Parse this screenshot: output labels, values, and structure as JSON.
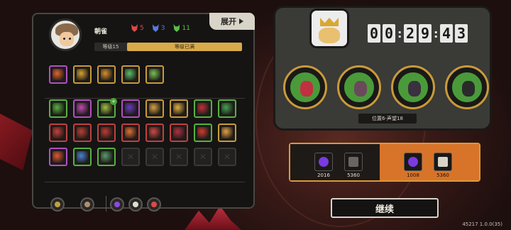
{
  "player": {
    "name": "朝雀",
    "level_label": "等级15",
    "level_status": "等级已满",
    "stats": [
      {
        "icon": "red-mask-icon",
        "value": "5",
        "color": "#e04848"
      },
      {
        "icon": "blue-mask-icon",
        "value": "3",
        "color": "#5a78e0"
      },
      {
        "icon": "green-mask-icon",
        "value": "11",
        "color": "#58c048"
      }
    ]
  },
  "panel": {
    "expand_label": "展开"
  },
  "relics": [
    {
      "icon": "flame-gauntlet-icon",
      "color": "#e0642a",
      "border": "#b050c0"
    },
    {
      "icon": "golden-claw-icon",
      "color": "#d8a030",
      "border": "#c89a3a"
    },
    {
      "icon": "bomb-icon",
      "color": "#d8902a",
      "border": "#c89a3a"
    },
    {
      "icon": "green-tree-icon",
      "color": "#58c068",
      "border": "#c89a3a"
    },
    {
      "icon": "green-swirl-icon",
      "color": "#78c050",
      "border": "#c89a3a"
    }
  ],
  "skills": {
    "rows": [
      [
        {
          "icon": "green-blade-icon",
          "color": "#58b040",
          "border": "#58b040"
        },
        {
          "icon": "purple-book-icon",
          "color": "#c04ab0",
          "border": "#b050c0"
        },
        {
          "icon": "green-staff-icon",
          "color": "#a0c040",
          "border": "#58b040",
          "badge": "+"
        },
        {
          "icon": "purple-cloak-icon",
          "color": "#6a3ac0",
          "border": "#b050c0"
        },
        {
          "icon": "golden-fist-icon",
          "color": "#d8a040",
          "border": "#c89a3a"
        },
        {
          "icon": "spark-burst-icon",
          "color": "#e0b040",
          "border": "#c89a3a"
        },
        {
          "icon": "red-cape-icon",
          "color": "#c03038",
          "border": "#58b040"
        },
        {
          "icon": "green-shrine-icon",
          "color": "#48a050",
          "border": "#58b040"
        }
      ],
      [
        {
          "icon": "triple-blades-icon",
          "color": "#c84038",
          "border": "#c04040"
        },
        {
          "icon": "crossed-swords-icon",
          "color": "#b84030",
          "border": "#c04040"
        },
        {
          "icon": "red-warrior-icon",
          "color": "#c03a30",
          "border": "#c04040"
        },
        {
          "icon": "fire-slash-icon",
          "color": "#e07030",
          "border": "#c04040"
        },
        {
          "icon": "demon-face-icon",
          "color": "#d04840",
          "border": "#c04040"
        },
        {
          "icon": "crimson-claw-icon",
          "color": "#b03040",
          "border": "#c04040"
        },
        {
          "icon": "red-sigil-icon",
          "color": "#d03a30",
          "border": "#58b040"
        },
        {
          "icon": "sun-fan-icon",
          "color": "#e0a040",
          "border": "#c89a3a"
        }
      ],
      [
        {
          "icon": "fire-dash-icon",
          "color": "#e05a30",
          "border": "#b050c0"
        },
        {
          "icon": "blue-spear-icon",
          "color": "#4a80d0",
          "border": "#58b040"
        },
        {
          "icon": "bird-spirit-icon",
          "color": "#5a9a6a",
          "border": "#58b040"
        },
        {
          "icon": "empty-slot-icon",
          "empty": true
        },
        {
          "icon": "empty-slot-icon",
          "empty": true
        },
        {
          "icon": "empty-slot-icon",
          "empty": true
        },
        {
          "icon": "empty-slot-icon",
          "empty": true
        },
        {
          "icon": "empty-slot-icon",
          "empty": true
        }
      ]
    ]
  },
  "bottom_bar": [
    {
      "icon": "target-ring-icon",
      "color": "#c0a040"
    },
    {
      "icon": "wand-icon",
      "color": "#b09070"
    },
    {
      "icon": "vortex-icon",
      "color": "#8a4ae0"
    },
    {
      "icon": "potion-icon",
      "color": "#e0e0d0"
    },
    {
      "icon": "star-burst-icon",
      "color": "#e04848"
    }
  ],
  "boss": {
    "icon": "king-portrait-icon"
  },
  "timer": {
    "digits": [
      "0",
      "0",
      "2",
      "9",
      "4",
      "3"
    ]
  },
  "enemies": [
    {
      "icon": "insect-enemy-icon",
      "feature_color": "#c03040"
    },
    {
      "icon": "horned-demon-icon",
      "feature_color": "#6a4a5a"
    },
    {
      "icon": "cloaked-figure-icon",
      "feature_color": "#3a3040"
    },
    {
      "icon": "glasses-man-icon",
      "feature_color": "#2a2a2a"
    }
  ],
  "position_label": "位置6-声望18",
  "rewards": {
    "left": [
      {
        "icon": "purple-orb-icon",
        "value": "2016",
        "color": "#7a3ae0"
      },
      {
        "icon": "dark-block-icon",
        "value": "5360",
        "color": "#6a6560"
      }
    ],
    "right": [
      {
        "icon": "purple-orb-icon",
        "value": "1008",
        "color": "#7a3ae0"
      },
      {
        "icon": "upgrade-block-icon",
        "value": "5360",
        "color": "#d8d4c8"
      }
    ]
  },
  "continue_label": "继续",
  "version": "45217 1.0.0(35)"
}
